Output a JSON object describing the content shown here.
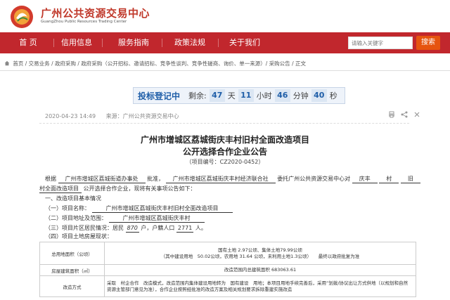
{
  "header": {
    "title": "广州公共资源交易中心",
    "subtitle": "GuangZhou Public Resources Trading Center"
  },
  "nav": {
    "items": [
      {
        "label": "首 页"
      },
      {
        "label": "信用信息"
      },
      {
        "label": "服务指南"
      },
      {
        "label": "政策法规"
      },
      {
        "label": "关于我们"
      }
    ],
    "search_placeholder": "请输入关键字",
    "search_button": "搜索"
  },
  "breadcrumb": {
    "text": "首页 / 交易业务 / 政府采购 / 政府采购（公开招标、邀请招标、竞争性谈判、竞争性磋商、询价、单一来源）/ 采购公告 / 正文"
  },
  "countdown": {
    "label": "投标登记中",
    "prefix": "剩余:",
    "days": "47",
    "days_unit": "天",
    "hours": "11",
    "hours_unit": "小时",
    "minutes": "46",
    "minutes_unit": "分钟",
    "seconds": "40",
    "seconds_unit": "秒"
  },
  "meta": {
    "date": "2020-04-23 14:49",
    "source": "来源：广州公共资源交易中心"
  },
  "article": {
    "title_line1": "广州市增城区荔城街庆丰村旧村全面改造项目",
    "title_line2": "公开选择合作企业公告",
    "code": "（项目编号：CZ2020-0452）",
    "para1_a": "根据",
    "para1_org": "广州市增城区荔城街道办事处",
    "para1_b": "批准，",
    "para1_org2": "广州市增城区荔城街庆丰村经济联合社",
    "para1_c": "委托广州公共资源交易中心对",
    "para1_village": "庆丰",
    "para1_d": "村",
    "para1_e": "旧",
    "para2_project": "村全面改造项目",
    "para2_rest": "公开选择合作企业，现将有关事项公告如下：",
    "section1": "一、改造项目基本情况",
    "item1_label": "（一）项目名称：",
    "item1_value": "广州市增城区荔城街庆丰村旧村全面改造项目",
    "item2_label": "（二）项目地址及范围：",
    "item2_value": "广州市增城区荔城街庆丰村",
    "item3_label": "（三）项目片区居民情况：居民",
    "item3_households": "870",
    "item3_mid": "户，户籍人口",
    "item3_people": "2771",
    "item3_end": "人。",
    "item4_label": "（四）项目土地房屋现状："
  },
  "table": {
    "row1_label": "总用地面积（公顷）",
    "row1_line1": "国有土地 2.97公顷、集体土地79.99公顷",
    "row1_line2": "（其中建设用地　50.02公顷，农用地 31.64 公顷，未利用土地1.3公顷）　　最终以政府批复为准",
    "row2_label": "房屋建筑面积（㎡）",
    "row2_value": "改造范围内总建筑面积 683063.61",
    "row3_label": "改造方式",
    "row3_line1": "采取　村企合作　改造模式，改造范围内集体建设用地转为　国有建设　用地；本项目用地手续完善后，采用“划拨/协议出让方式供地（以规划和自然",
    "row3_line2": "资源主管部门意见为准），合作企业按照经批准的改造方案及相关规划要求拆除重建实施改造"
  },
  "colors": {
    "brand_red": "#c1272d",
    "search_orange": "#e6540f",
    "countdown_blue": "#1f5ea8"
  }
}
